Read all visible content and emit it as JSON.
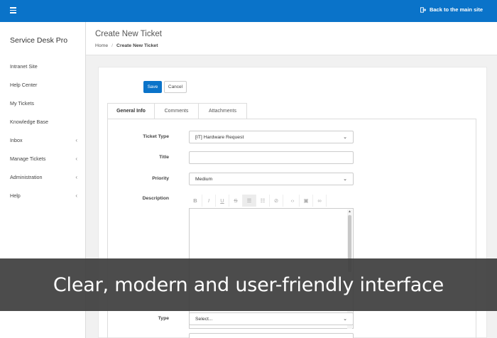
{
  "topbar": {
    "back_label": "Back to the main site"
  },
  "sidebar": {
    "brand": "Service Desk Pro",
    "items": [
      {
        "label": "Intranet Site",
        "has_chevron": false
      },
      {
        "label": "Help Center",
        "has_chevron": false
      },
      {
        "label": "My Tickets",
        "has_chevron": false
      },
      {
        "label": "Knowledge Base",
        "has_chevron": false
      },
      {
        "label": "Inbox",
        "has_chevron": true
      },
      {
        "label": "Manage Tickets",
        "has_chevron": true
      },
      {
        "label": "Administration",
        "has_chevron": true
      },
      {
        "label": "Help",
        "has_chevron": true
      }
    ],
    "chevron_glyph": "‹"
  },
  "page": {
    "title": "Create New Ticket",
    "breadcrumb": {
      "home": "Home",
      "separator": "/",
      "current": "Create New Ticket"
    }
  },
  "form": {
    "save_label": "Save",
    "cancel_label": "Cancel",
    "tabs": [
      {
        "label": "General Info",
        "active": true
      },
      {
        "label": "Comments",
        "active": false
      },
      {
        "label": "Attachments",
        "active": false
      }
    ],
    "fields": {
      "ticket_type": {
        "label": "Ticket Type",
        "value": "[IT] Hardware Request"
      },
      "title": {
        "label": "Title",
        "value": ""
      },
      "priority": {
        "label": "Priority",
        "value": "Medium"
      },
      "description": {
        "label": "Description"
      },
      "type": {
        "label": "Type",
        "value": "Select..."
      }
    },
    "toolbar_icons": [
      "bold-icon",
      "italic-icon",
      "underline-icon",
      "strikethrough-icon",
      "bulleted-list-icon",
      "numbered-list-icon",
      "clear-format-icon",
      "code-icon",
      "image-icon",
      "link-icon"
    ]
  },
  "overlay": {
    "caption": "Clear, modern and user-friendly interface"
  },
  "colors": {
    "accent": "#0a73c9",
    "overlay": "#3e3e3e"
  }
}
